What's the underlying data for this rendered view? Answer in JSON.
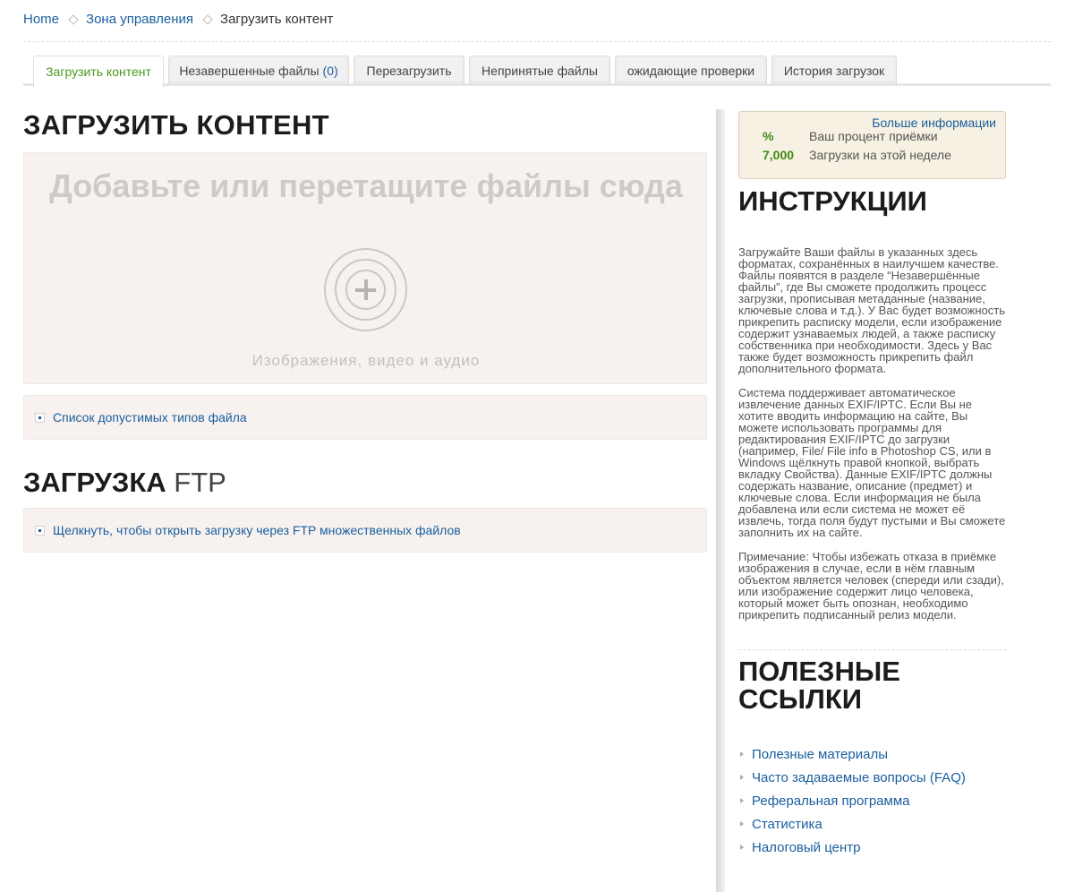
{
  "breadcrumb": {
    "items": [
      "Home",
      "Зона управления"
    ],
    "current": "Загрузить контент"
  },
  "tabs": [
    {
      "label": "Загрузить контент",
      "active": true
    },
    {
      "label": "Незавершенные файлы",
      "count": "(0)"
    },
    {
      "label": "Перезагрузить"
    },
    {
      "label": "Непринятые файлы"
    },
    {
      "label": "ожидающие проверки"
    },
    {
      "label": "История загрузок"
    }
  ],
  "upload": {
    "heading": "ЗАГРУЗИТЬ КОНТЕНТ",
    "drop_title": "Добавьте или перетащите файлы сюда",
    "drop_subtitle": "Изображения, видео и аудио",
    "file_types_link": "Список допустимых типов файла"
  },
  "ftp": {
    "heading_strong": "ЗАГРУЗКА",
    "heading_light": "FTP",
    "link": "Щелкнуть, чтобы открыть загрузку через FTP множественных файлов"
  },
  "stats": {
    "more_info": "Больше информации",
    "acceptance_value": "%",
    "acceptance_label": "Ваш процент приёмки",
    "weekly_value": "7,000",
    "weekly_label": "Загрузки на этой неделе"
  },
  "instructions": {
    "heading": "ИНСТРУКЦИИ",
    "p1": "Загружайте Ваши файлы в указанных здесь форматах, сохранённых в наилучшем качестве. Файлы появятся в разделе “Незавершённые файлы”, где Вы сможете продолжить процесс загрузки, прописывая метаданные (название, ключевые слова и т.д.). У Вас будет возможность прикрепить расписку модели, если изображение содержит узнаваемых людей, а также расписку собственника при необходимости. Здесь у Вас также будет возможность прикрепить файл дополнительного формата.",
    "p2": "Система поддерживает автоматическое извлечение данных EXIF/IPTC. Если Вы не хотите вводить информацию на сайте, Вы можете использовать программы для редактирования EXIF/IPTC до загрузки (например, File/ File info в Photoshop CS, или в Windows щёлкнуть правой кнопкой, выбрать вкладку Свойства). Данные EXIF/IPTC должны содержать название, описание (предмет) и ключевые слова. Если информация не была добавлена или если система не может её извлечь, тогда поля будут пустыми и Вы сможете заполнить их на сайте.",
    "p3": "Примечание: Чтобы избежать отказа в приёмке изображения в случае, если в нём главным объектом является человек (спереди или сзади), или изображение содержит лицо человека, который может быть опознан, необходимо прикрепить подписанный релиз модели."
  },
  "useful_links": {
    "heading": "ПОЛЕЗНЫЕ ССЫЛКИ",
    "items": [
      "Полезные материалы",
      "Часто задаваемые вопросы (FAQ)",
      "Реферальная программа",
      "Статистика",
      "Налоговый центр"
    ]
  }
}
